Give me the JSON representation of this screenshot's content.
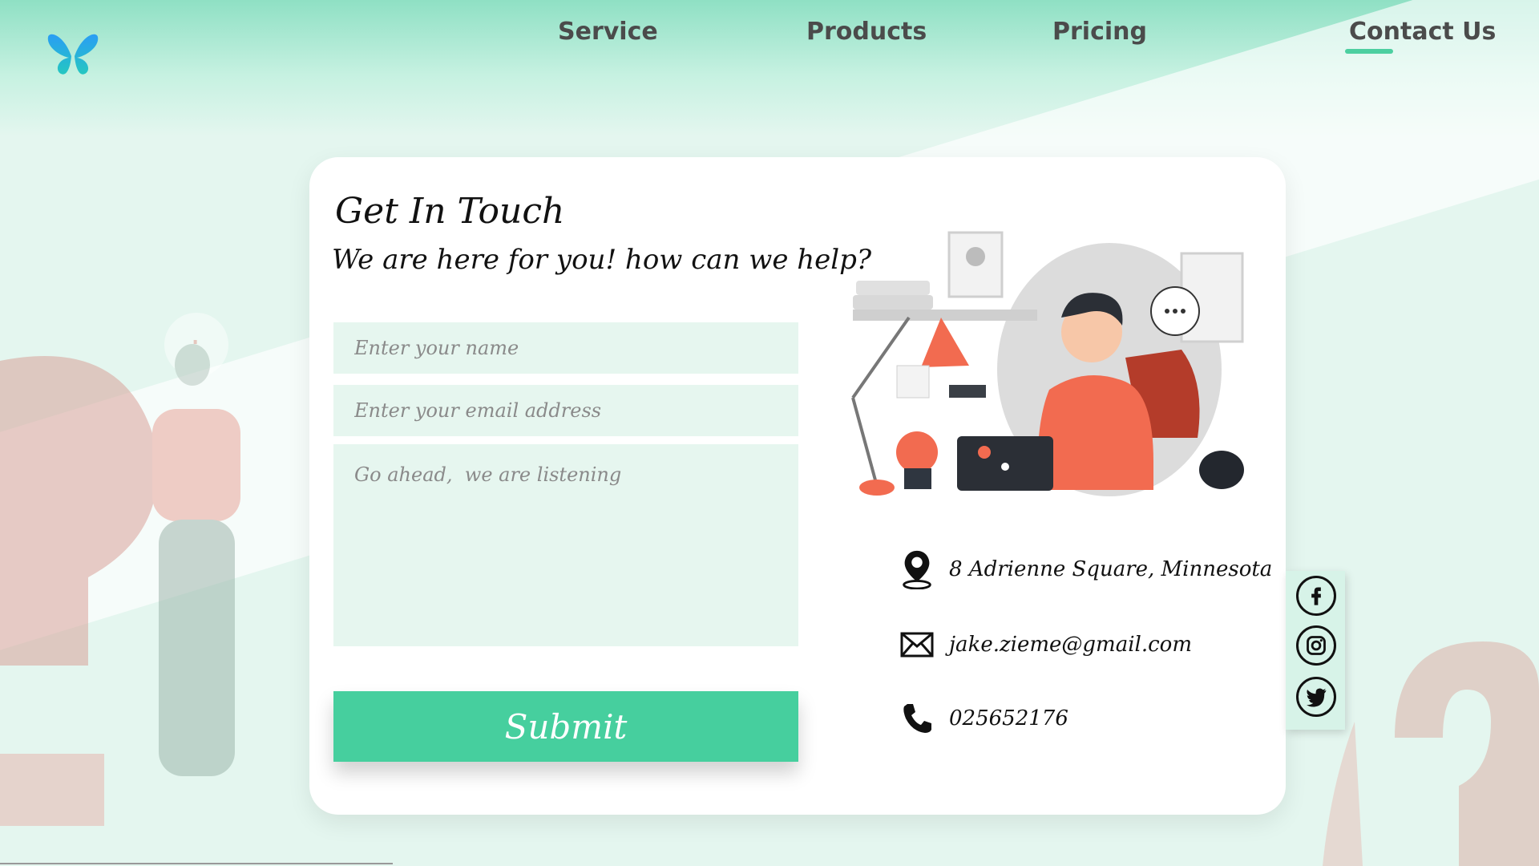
{
  "nav": {
    "logo_icon": "butterfly-icon",
    "items": [
      {
        "label": "Service"
      },
      {
        "label": "Products"
      },
      {
        "label": "Pricing"
      },
      {
        "label": "Contact Us",
        "active": true
      }
    ]
  },
  "contact": {
    "title": "Get In Touch",
    "subtitle": "We are here for you! how can we help?",
    "name_placeholder": "Enter your name",
    "email_placeholder": "Enter your email address",
    "message_placeholder": "Go ahead,  we are listening",
    "submit_label": "Submit"
  },
  "info": {
    "address": "8 Adrienne Square, Minnesota",
    "email": "jake.zieme@gmail.com",
    "phone": "025652176"
  },
  "social": [
    "facebook-icon",
    "instagram-icon",
    "twitter-icon"
  ],
  "colors": {
    "accent": "#46cf9e",
    "nav_text": "#4b4b4b",
    "field_bg": "#e6f6ef",
    "illustration": "#f26b50"
  }
}
